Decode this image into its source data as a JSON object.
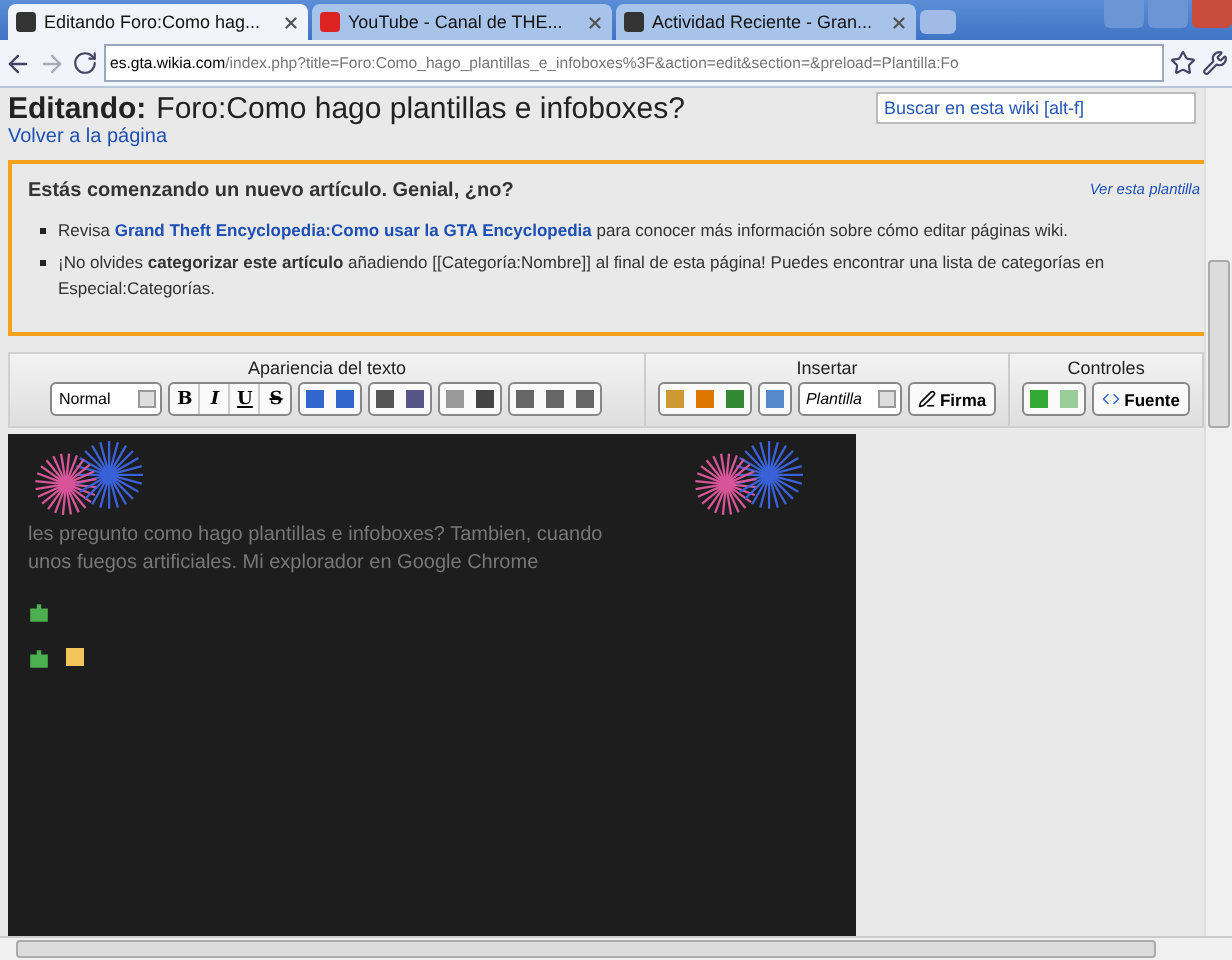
{
  "tabs": [
    {
      "label": "Editando Foro:Como hag...",
      "selected": true,
      "kind": "wiki"
    },
    {
      "label": "YouTube - Canal de THE...",
      "selected": false,
      "kind": "video"
    },
    {
      "label": "Actividad Reciente - Gran...",
      "selected": false,
      "kind": "wiki"
    }
  ],
  "address": {
    "host": "es.gta.wikia.com",
    "path": "/index.php?title=Foro:Como_hago_plantillas_e_infoboxes%3F&action=edit&section=&preload=Plantilla:Fo"
  },
  "page": {
    "heading_prefix": "Editando:",
    "heading": "Foro:Como hago plantillas e infoboxes?",
    "back_link": "Volver a la página",
    "search": {
      "placeholder": "Buscar en esta wiki [alt-f]"
    }
  },
  "notice": {
    "title": "Estás comenzando un nuevo artículo. Genial, ¿no?",
    "template_link": "Ver esta plantilla",
    "items": [
      "Revisa **Grand Theft Encyclopedia:Como usar la GTA Encyclopedia** para conocer más información sobre cómo editar páginas wiki.",
      "¡No olvides **categorizar este artículo** añadiendo [[Categoría:Nombre]] al final de esta página! Puedes encontrar una lista de categorías en Especial:Categorías."
    ]
  },
  "toolbar": {
    "groups": [
      {
        "title": "Apariencia del texto",
        "format": "Normal",
        "style_buttons": [
          "B",
          "I",
          "U",
          "S"
        ]
      },
      {
        "title": "Insertar",
        "template": "Plantilla",
        "signature": "Firma"
      },
      {
        "title": "Controles",
        "source": "Fuente"
      }
    ]
  },
  "editor": {
    "lines": [
      "les pregunto como hago plantillas e infoboxes? Tambien, cuando",
      "unos fuegos artificiales. Mi explorador en Google Chrome"
    ]
  }
}
